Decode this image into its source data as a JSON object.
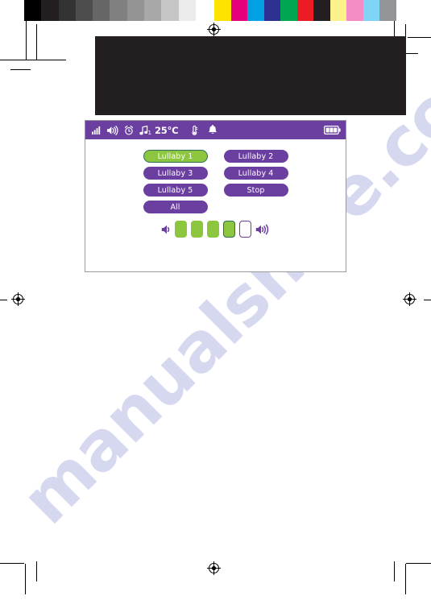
{
  "page": {
    "background_color": "#ffffff",
    "watermark_text": "manualshive.com",
    "watermark_color": "#c9cbec"
  },
  "print_marks": {
    "gray_ramp": [
      "#000000",
      "#231f20",
      "#333333",
      "#4d4d4d",
      "#666666",
      "#808080",
      "#949494",
      "#a8a8a8",
      "#c6c6c6",
      "#ebebeb",
      "#ffffff"
    ],
    "color_ramp": [
      "#fce300",
      "#e6007e",
      "#00a0e3",
      "#2e3192",
      "#00a651",
      "#ed1c24",
      "#231f20",
      "#fdf18c",
      "#f happened",
      "#7fd4f5",
      "#939598"
    ],
    "color_ramp_fixed": [
      "#fce300",
      "#e6007e",
      "#00a0e3",
      "#2e3192",
      "#00a651",
      "#ed1c24",
      "#231f20",
      "#fdf18c",
      "#f48cc6",
      "#7fd4f5",
      "#939598"
    ]
  },
  "black_plate": {
    "color": "#231f20",
    "label": ""
  },
  "device": {
    "screen_background": "#ffffff",
    "accent_purple": "#6b3fa0",
    "accent_green": "#8cc63f",
    "selected_border": "#2f6b5e",
    "status_bar": {
      "icons": [
        {
          "name": "signal-strength-icon",
          "glyph": "signal"
        },
        {
          "name": "speaker-volume-icon",
          "glyph": "speaker"
        },
        {
          "name": "alarm-clock-icon",
          "glyph": "alarm"
        },
        {
          "name": "music-note-icon",
          "glyph": "note",
          "subscript": "1"
        }
      ],
      "temperature": "25°C",
      "right_icons": [
        {
          "name": "thermometer-icon",
          "glyph": "thermometer"
        },
        {
          "name": "bell-alert-icon",
          "glyph": "bell"
        }
      ],
      "battery": {
        "name": "battery-icon",
        "level": 3,
        "segments": 3
      }
    },
    "menu": {
      "title": "",
      "buttons": [
        {
          "id": "lullaby-1",
          "label": "Lullaby 1",
          "selected": true
        },
        {
          "id": "lullaby-2",
          "label": "Lullaby 2",
          "selected": false
        },
        {
          "id": "lullaby-3",
          "label": "Lullaby 3",
          "selected": false
        },
        {
          "id": "lullaby-4",
          "label": "Lullaby 4",
          "selected": false
        },
        {
          "id": "lullaby-5",
          "label": "Lullaby 5",
          "selected": false
        },
        {
          "id": "stop",
          "label": "Stop",
          "selected": false
        },
        {
          "id": "all",
          "label": "All",
          "selected": false
        }
      ]
    },
    "volume": {
      "min_icon": "speaker-low-icon",
      "max_icon": "speaker-high-icon",
      "level": 4,
      "total_steps": 5,
      "segments": [
        {
          "index": 1,
          "state": "filled"
        },
        {
          "index": 2,
          "state": "filled"
        },
        {
          "index": 3,
          "state": "filled"
        },
        {
          "index": 4,
          "state": "filled-current"
        },
        {
          "index": 5,
          "state": "empty"
        }
      ]
    }
  }
}
